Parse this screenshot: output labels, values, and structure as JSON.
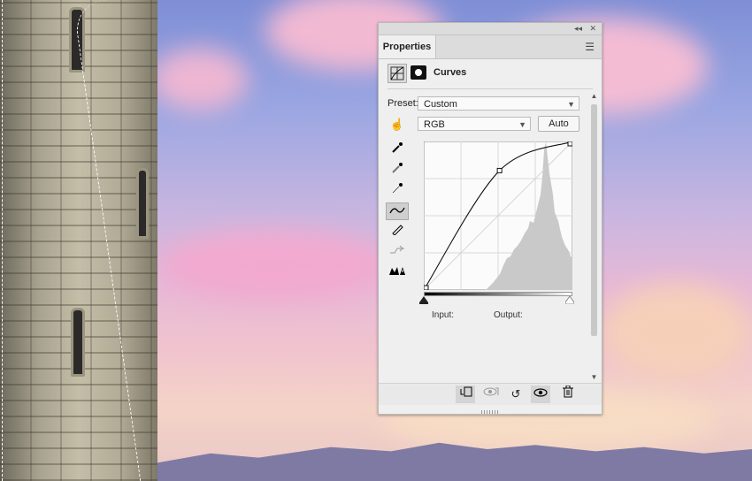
{
  "panel": {
    "tab_label": "Properties",
    "adjustment_title": "Curves",
    "preset_label": "Preset:",
    "preset_value": "Custom",
    "channel_value": "RGB",
    "auto_label": "Auto",
    "input_label": "Input:",
    "output_label": "Output:"
  },
  "icons": {
    "collapse": "double-chevron-left",
    "close": "close",
    "menu": "hamburger-menu",
    "curves_layer": "curves-grid",
    "mask": "layer-mask",
    "targeted_adjust": "hand-adjust",
    "black_point": "eyedropper-black",
    "gray_point": "eyedropper-gray",
    "white_point": "eyedropper-white",
    "edit_points": "curve-points",
    "draw_curve": "pencil",
    "smooth": "smooth-curve",
    "clipping_warning": "clipping-warning",
    "clip_to_layer": "clip-to-layer",
    "view_previous": "view-previous-state",
    "reset": "reset-arrow",
    "visibility": "eye",
    "delete": "trash"
  },
  "curve": {
    "points": [
      [
        0,
        0
      ],
      [
        130,
        205
      ],
      [
        255,
        255
      ]
    ]
  },
  "colors": {
    "panel_bg": "#efefef",
    "panel_header": "#dcdcdc",
    "histogram": "#c9c9c9"
  }
}
